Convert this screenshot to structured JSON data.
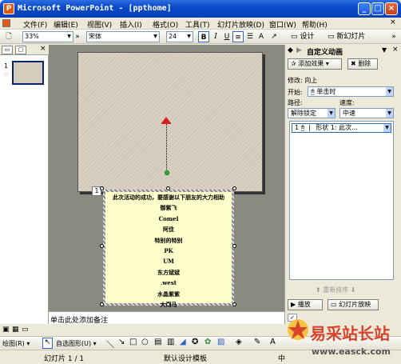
{
  "window": {
    "title": "Microsoft PowerPoint - [ppthome]",
    "app_icon": "P"
  },
  "menus": [
    "文件(F)",
    "编辑(E)",
    "视图(V)",
    "插入(I)",
    "格式(O)",
    "工具(T)",
    "幻灯片放映(D)",
    "窗口(W)",
    "帮助(H)"
  ],
  "toolbar": {
    "zoom": "33%",
    "font": "宋体",
    "font_size": "24",
    "bold": "B",
    "italic": "I",
    "underline": "U",
    "design_label": "设计",
    "new_slide_label": "新幻灯片"
  },
  "slides_panel": {
    "slide_number": "1"
  },
  "slide": {
    "animation_tag": "1",
    "lines": [
      "此次活动的成功，要感谢以下朋友的大力相助",
      "御紫飞",
      "Comel",
      "阿佳",
      "特别的特别",
      "PK",
      "UM",
      "东方斌斌",
      ".west",
      "水晶紫紫",
      "大河马"
    ]
  },
  "notes": {
    "placeholder": "单击此处添加备注"
  },
  "task_pane": {
    "title": "自定义动画",
    "add_effect": "添加效果",
    "remove": "删除",
    "modify": "修改: 向上",
    "start_label": "开始:",
    "start_value": "单击时",
    "path_label": "路径:",
    "speed_label": "速度:",
    "path_value": "解除锁定",
    "speed_value": "中速",
    "list_item": {
      "number": "1",
      "text": "形状 1: 此次..."
    },
    "reorder": "重新排序",
    "play": "播放",
    "slideshow": "幻灯片放映"
  },
  "drawbar": {
    "draw": "绘图(R)",
    "autoshapes": "自选图形(U)"
  },
  "status": {
    "slide": "幻灯片 1 / 1",
    "template": "默认设计模板",
    "lang": "中"
  },
  "watermark": {
    "text": "易采站长站",
    "url": "www.easck.com"
  }
}
